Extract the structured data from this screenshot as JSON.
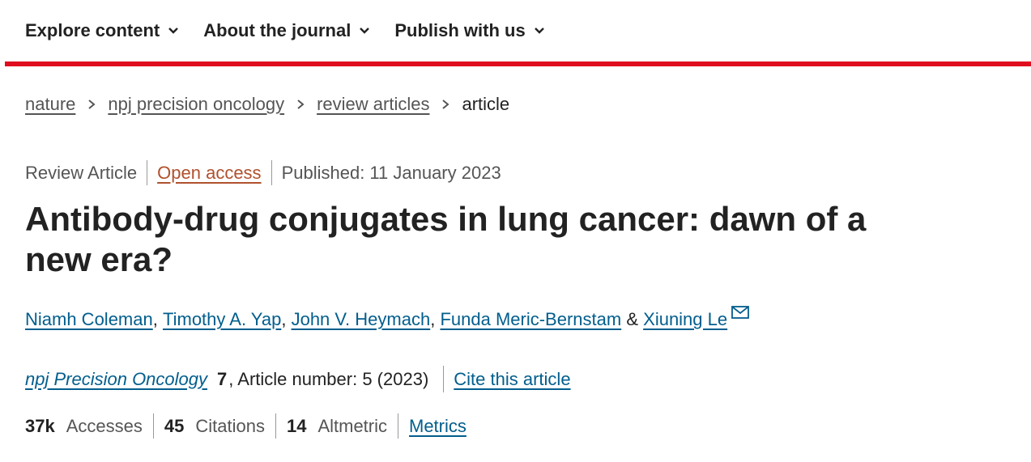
{
  "nav": {
    "items": [
      {
        "label": "Explore content"
      },
      {
        "label": "About the journal"
      },
      {
        "label": "Publish with us"
      }
    ]
  },
  "colors": {
    "accent_bar": "#e00d1f",
    "link": "#025e8d",
    "open_access": "#b0512d"
  },
  "breadcrumb": {
    "items": [
      "nature",
      "npj precision oncology",
      "review articles"
    ],
    "current": "article"
  },
  "meta": {
    "type": "Review Article",
    "access": "Open access",
    "published": "Published: 11 January 2023"
  },
  "title": "Antibody-drug conjugates in lung cancer: dawn of a new era?",
  "authors": {
    "names": [
      "Niamh Coleman",
      "Timothy A. Yap",
      "John V. Heymach",
      "Funda Meric-Bernstam",
      "Xiuning Le"
    ],
    "comma": ",",
    "and": "&",
    "corresponding_icon": "mail-icon"
  },
  "journal": {
    "name": "npj Precision Oncology",
    "volume": "7",
    "article_info": ", Article number: 5 (2023)",
    "cite_label": "Cite this article"
  },
  "metrics": {
    "accesses_value": "37k",
    "accesses_label": "Accesses",
    "citations_value": "45",
    "citations_label": "Citations",
    "altmetric_value": "14",
    "altmetric_label": "Altmetric",
    "metrics_link": "Metrics"
  }
}
